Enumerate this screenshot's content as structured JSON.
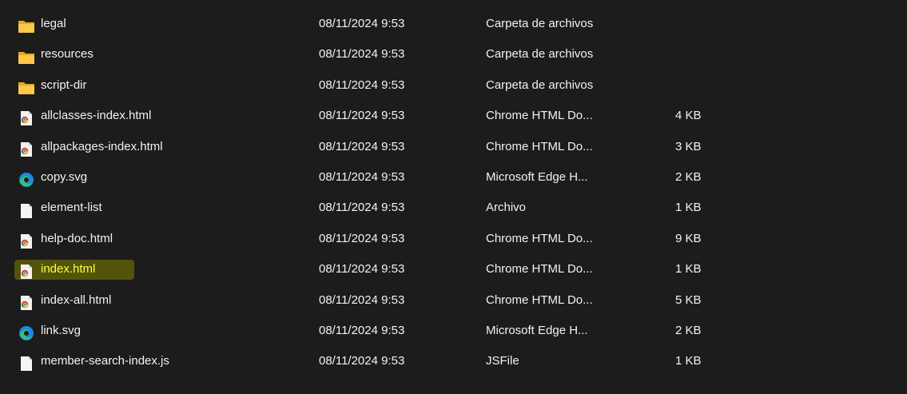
{
  "window": {
    "background": "#1c1c1c",
    "text_color": "#f2f2f2",
    "highlight_text_color": "#ffff3a"
  },
  "files": [
    {
      "name": "legal",
      "modified": "08/11/2024 9:53",
      "type": "Carpeta de archivos",
      "size": "",
      "icon": "folder-icon"
    },
    {
      "name": "resources",
      "modified": "08/11/2024 9:53",
      "type": "Carpeta de archivos",
      "size": "",
      "icon": "folder-icon"
    },
    {
      "name": "script-dir",
      "modified": "08/11/2024 9:53",
      "type": "Carpeta de archivos",
      "size": "",
      "icon": "folder-icon"
    },
    {
      "name": "allclasses-index.html",
      "modified": "08/11/2024 9:53",
      "type": "Chrome HTML Do...",
      "size": "4 KB",
      "icon": "chrome-html-file-icon"
    },
    {
      "name": "allpackages-index.html",
      "modified": "08/11/2024 9:53",
      "type": "Chrome HTML Do...",
      "size": "3 KB",
      "icon": "chrome-html-file-icon"
    },
    {
      "name": "copy.svg",
      "modified": "08/11/2024 9:53",
      "type": "Microsoft Edge H...",
      "size": "2 KB",
      "icon": "edge-icon"
    },
    {
      "name": "element-list",
      "modified": "08/11/2024 9:53",
      "type": "Archivo",
      "size": "1 KB",
      "icon": "blank-file-icon"
    },
    {
      "name": "help-doc.html",
      "modified": "08/11/2024 9:53",
      "type": "Chrome HTML Do...",
      "size": "9 KB",
      "icon": "chrome-html-file-icon"
    },
    {
      "name": "index.html",
      "modified": "08/11/2024 9:53",
      "type": "Chrome HTML Do...",
      "size": "1 KB",
      "icon": "chrome-html-file-icon",
      "highlighted": true
    },
    {
      "name": "index-all.html",
      "modified": "08/11/2024 9:53",
      "type": "Chrome HTML Do...",
      "size": "5 KB",
      "icon": "chrome-html-file-icon"
    },
    {
      "name": "link.svg",
      "modified": "08/11/2024 9:53",
      "type": "Microsoft Edge H...",
      "size": "2 KB",
      "icon": "edge-icon"
    },
    {
      "name": "member-search-index.js",
      "modified": "08/11/2024 9:53",
      "type": "JSFile",
      "size": "1 KB",
      "icon": "blank-file-icon"
    }
  ]
}
